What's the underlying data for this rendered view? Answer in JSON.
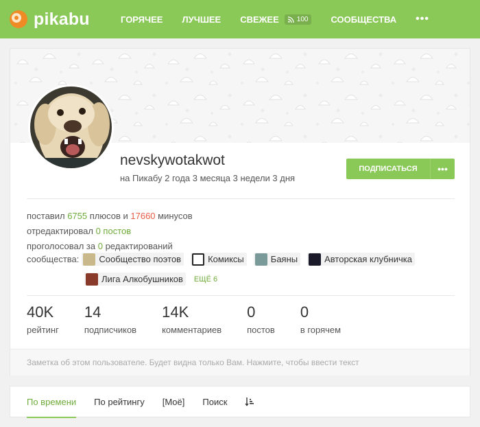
{
  "header": {
    "logo_text": "pikabu",
    "nav": [
      {
        "label": "ГОРЯЧЕЕ"
      },
      {
        "label": "ЛУЧШЕЕ"
      },
      {
        "label": "СВЕЖЕЕ",
        "badge": "100"
      },
      {
        "label": "СООБЩЕСТВА"
      }
    ],
    "more_label": "•••"
  },
  "profile": {
    "username": "nevskywotakwot",
    "since": "на Пикабу 2 года 3 месяца 3 недели 3 дня",
    "subscribe_label": "ПОДПИСАТЬСЯ",
    "more_label": "•••"
  },
  "activity": {
    "line1_prefix": "поставил ",
    "pluses": "6755",
    "line1_mid": " плюсов и ",
    "minuses": "17660",
    "line1_suffix": " минусов",
    "line2_prefix": "отредактировал ",
    "edited": "0 постов",
    "line3_prefix": "проголосовал за ",
    "voted": "0",
    "line3_suffix": " редактирований"
  },
  "communities": {
    "label": "сообщества:",
    "items": [
      {
        "name": "Сообщество поэтов"
      },
      {
        "name": "Комиксы"
      },
      {
        "name": "Баяны"
      },
      {
        "name": "Авторская клубничка"
      },
      {
        "name": "Лига Алкобушников"
      }
    ],
    "more_label": "ЕЩЁ 6"
  },
  "stats": [
    {
      "value": "40K",
      "label": "рейтинг"
    },
    {
      "value": "14",
      "label": "подписчиков"
    },
    {
      "value": "14K",
      "label": "комментариев"
    },
    {
      "value": "0",
      "label": "постов"
    },
    {
      "value": "0",
      "label": "в горячем"
    }
  ],
  "note_placeholder": "Заметка об этом пользователе. Будет видна только Вам. Нажмите, чтобы ввести текст",
  "tabs": [
    {
      "label": "По времени",
      "active": true
    },
    {
      "label": "По рейтингу"
    },
    {
      "label": "[Моё]"
    },
    {
      "label": "Поиск"
    }
  ],
  "colors": {
    "accent_green": "#8ac858",
    "text_green": "#6fab3a",
    "text_red": "#e85d48"
  }
}
